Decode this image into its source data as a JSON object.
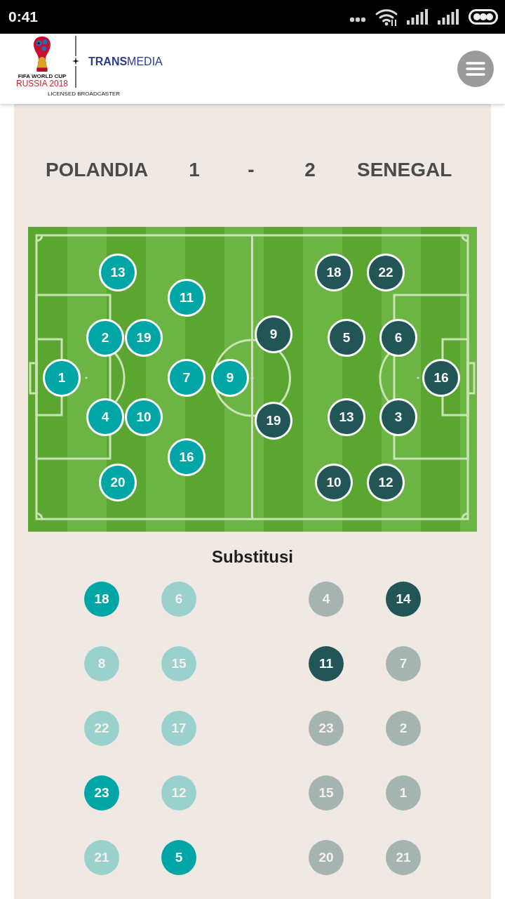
{
  "status_bar": {
    "time": "0:41"
  },
  "header": {
    "event_logo": {
      "tournament": "FIFA WORLD CUP",
      "edition": "RUSSIA 2018"
    },
    "broadcaster": "**TRANS**MEDIA",
    "caption": "LICENSED BROADCASTER"
  },
  "scoreboard": {
    "home_team": "POLANDIA",
    "home_goals": "1",
    "separator": "-",
    "away_goals": "2",
    "away_team": "SENEGAL"
  },
  "pitch": {
    "teams": [
      {
        "color": "#00a6a6",
        "players": [
          {
            "number": "1"
          },
          {
            "number": "13"
          },
          {
            "number": "2"
          },
          {
            "number": "4"
          },
          {
            "number": "20"
          },
          {
            "number": "19"
          },
          {
            "number": "10"
          },
          {
            "number": "11"
          },
          {
            "number": "7"
          },
          {
            "number": "16"
          },
          {
            "number": "9"
          }
        ]
      },
      {
        "color": "#215556",
        "players": [
          {
            "number": "16"
          },
          {
            "number": "22"
          },
          {
            "number": "6"
          },
          {
            "number": "3"
          },
          {
            "number": "12"
          },
          {
            "number": "18"
          },
          {
            "number": "5"
          },
          {
            "number": "13"
          },
          {
            "number": "10"
          },
          {
            "number": "9"
          },
          {
            "number": "19"
          }
        ]
      }
    ]
  },
  "substitutes": {
    "title": "Substitusi",
    "teams": [
      {
        "players": [
          {
            "number": "18",
            "active": true
          },
          {
            "number": "6",
            "active": false
          },
          {
            "number": "8",
            "active": false
          },
          {
            "number": "15",
            "active": false
          },
          {
            "number": "22",
            "active": false
          },
          {
            "number": "17",
            "active": false
          },
          {
            "number": "23",
            "active": true
          },
          {
            "number": "12",
            "active": false
          },
          {
            "number": "21",
            "active": false
          },
          {
            "number": "5",
            "active": true
          }
        ]
      },
      {
        "players": [
          {
            "number": "4",
            "active": false
          },
          {
            "number": "14",
            "active": true
          },
          {
            "number": "11",
            "active": true
          },
          {
            "number": "7",
            "active": false
          },
          {
            "number": "23",
            "active": false
          },
          {
            "number": "2",
            "active": false
          },
          {
            "number": "15",
            "active": false
          },
          {
            "number": "1",
            "active": false
          },
          {
            "number": "20",
            "active": false
          },
          {
            "number": "21",
            "active": false
          }
        ]
      }
    ]
  }
}
